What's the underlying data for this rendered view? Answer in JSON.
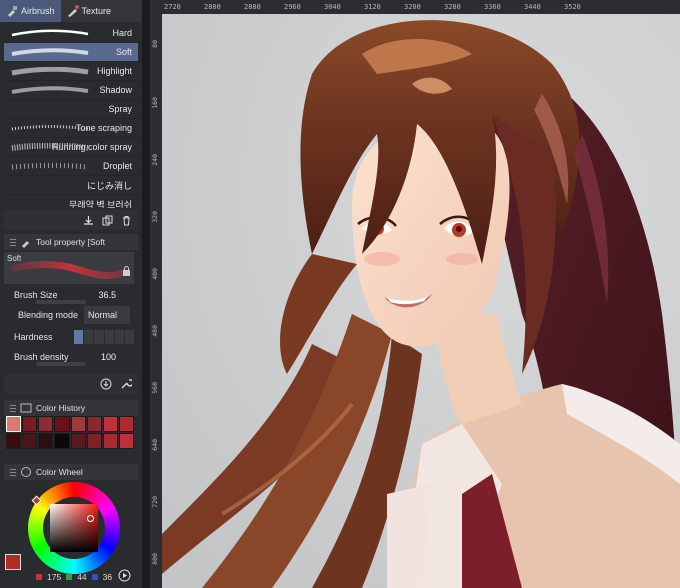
{
  "panel": {
    "tabs": [
      {
        "label": "Airbrush",
        "icon": "airbrush-icon",
        "active": true
      },
      {
        "label": "Texture",
        "icon": "texture-brush-icon",
        "active": false
      }
    ],
    "brushes": [
      {
        "label": "Hard",
        "selected": false
      },
      {
        "label": "Soft",
        "selected": true
      },
      {
        "label": "Highlight",
        "selected": false
      },
      {
        "label": "Shadow",
        "selected": false
      },
      {
        "label": "Spray",
        "selected": false
      },
      {
        "label": "Tone scraping",
        "selected": false
      },
      {
        "label": "Running color spray",
        "selected": false
      },
      {
        "label": "Droplet",
        "selected": false
      },
      {
        "label": "にじみ消し",
        "selected": false
      },
      {
        "label": "무래약 벽 브러쉬",
        "selected": false
      }
    ]
  },
  "tool_property": {
    "title": "Tool property [Soft",
    "preview_label": "Soft",
    "brush_size": {
      "label": "Brush Size",
      "value": "36.5"
    },
    "blending_mode": {
      "label": "Blending mode",
      "value": "Normal"
    },
    "hardness": {
      "label": "Hardness",
      "level": 1,
      "steps": 6
    },
    "brush_density": {
      "label": "Brush density",
      "value": "100"
    }
  },
  "color_history": {
    "title": "Color History",
    "swatches": [
      "#dc7a6e",
      "#7a1a22",
      "#8e2a33",
      "#6b1018",
      "#a13a3f",
      "#8a2a30",
      "#c0303a",
      "#b02a2f",
      "#3a0c10",
      "#4d1518",
      "#2a0f10",
      "#0a0a0a",
      "#5a1a1d",
      "#7e2225",
      "#a82a30",
      "#c03038"
    ]
  },
  "color_wheel": {
    "title": "Color Wheel",
    "current": "#af2c24",
    "r": "175",
    "g": "44",
    "b": "36"
  },
  "ruler": {
    "h_ticks": [
      "2720",
      "2800",
      "2880",
      "2960",
      "3040",
      "3120",
      "3200",
      "3280",
      "3360",
      "3440",
      "3520"
    ],
    "v_ticks": [
      "80",
      "160",
      "240",
      "320",
      "400",
      "480",
      "560",
      "640",
      "720",
      "800"
    ]
  },
  "colors": {
    "accent": "#5a6a8e",
    "panel_bg": "#2a2b2e",
    "canvas_bg": "#cfd0d2"
  }
}
